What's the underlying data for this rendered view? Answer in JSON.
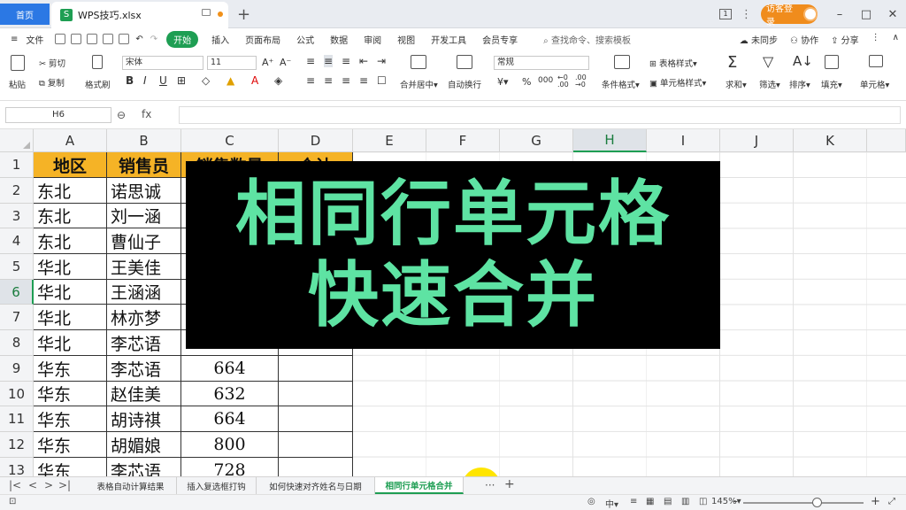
{
  "titlebar": {
    "home_tab": "首页",
    "file_tab": "WPS技巧.xlsx",
    "new_tab": "+",
    "guest_login": "访客登录",
    "window_controls": [
      "–",
      "□",
      "✕"
    ]
  },
  "menu": {
    "file": "文件",
    "tabs": [
      "开始",
      "插入",
      "页面布局",
      "公式",
      "数据",
      "审阅",
      "视图",
      "开发工具",
      "会员专享"
    ],
    "active_tab": "开始",
    "search": "查找命令、搜索模板",
    "sync": "未同步",
    "collab": "协作",
    "share": "分享"
  },
  "ribbon": {
    "paste": "粘贴",
    "cut": "剪切",
    "copy": "复制",
    "format_painter": "格式刷",
    "font_name": "宋体",
    "font_size": "11",
    "number_format": "常规",
    "merge_center": "合并居中",
    "wrap_text": "自动换行",
    "cond_format": "条件格式",
    "table_style": "表格样式",
    "cell_style": "单元格样式",
    "sum": "求和",
    "filter": "筛选",
    "sort": "排序",
    "fill": "填充",
    "cell": "单元格",
    "bold": "B",
    "italic": "I",
    "underline": "U",
    "currency": "¥",
    "percent": "%",
    "thousands": "000"
  },
  "formula_bar": {
    "name_box": "H6",
    "fx": "fx",
    "formula": ""
  },
  "columns": [
    "A",
    "B",
    "C",
    "D",
    "E",
    "F",
    "G",
    "H",
    "I",
    "J",
    "K"
  ],
  "selected_column": "H",
  "selected_row": "6",
  "rows": [
    "1",
    "2",
    "3",
    "4",
    "5",
    "6",
    "7",
    "8",
    "9",
    "10",
    "11",
    "12",
    "13"
  ],
  "table": {
    "headers": [
      "地区",
      "销售员",
      "销售数量",
      "合计"
    ],
    "rows": [
      [
        "东北",
        "诺思诚",
        "",
        ""
      ],
      [
        "东北",
        "刘一涵",
        "",
        ""
      ],
      [
        "东北",
        "曹仙子",
        "",
        ""
      ],
      [
        "华北",
        "王美佳",
        "",
        ""
      ],
      [
        "华北",
        "王涵涵",
        "",
        ""
      ],
      [
        "华北",
        "林亦梦",
        "",
        ""
      ],
      [
        "华北",
        "李芯语",
        "",
        ""
      ],
      [
        "华东",
        "李芯语",
        "664",
        ""
      ],
      [
        "华东",
        "赵佳美",
        "632",
        ""
      ],
      [
        "华东",
        "胡诗祺",
        "664",
        ""
      ],
      [
        "华东",
        "胡媚娘",
        "800",
        ""
      ],
      [
        "华东",
        "李芯语",
        "728",
        ""
      ]
    ]
  },
  "overlay": {
    "line1": "相同行单元格",
    "line2": "快速合并"
  },
  "sheet_tabs": [
    "表格自动计算结果",
    "插入复选框打钩",
    "如何快速对齐姓名与日期",
    "相同行单元格合并"
  ],
  "active_sheet": "相同行单元格合并",
  "sheet_more": "···",
  "status": {
    "zoom": "145%",
    "zoom_minus": "–",
    "zoom_plus": "+"
  },
  "colors": {
    "accent": "#1e9e53",
    "header_fill": "#f5b326",
    "overlay_text": "#5ee3a3"
  }
}
